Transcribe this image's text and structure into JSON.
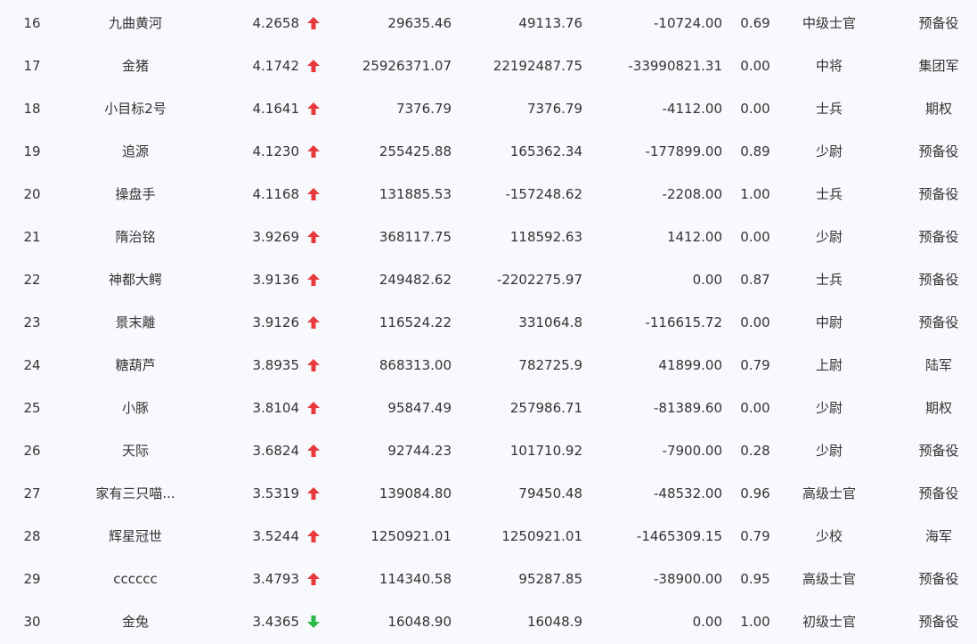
{
  "colors": {
    "up": "#e8393d",
    "down": "#2db845",
    "text": "#333333",
    "background": "#f8f9fc"
  },
  "rows": [
    {
      "rank": "16",
      "name": "九曲黄河",
      "score": "4.2658",
      "trend": "up",
      "trend_icon": "arrow-up-icon",
      "v1": "29635.46",
      "v2": "49113.76",
      "v3": "-10724.00",
      "ratio": "0.69",
      "title": "中级士官",
      "type": "预备役"
    },
    {
      "rank": "17",
      "name": "金猪",
      "score": "4.1742",
      "trend": "up",
      "trend_icon": "arrow-up-icon",
      "v1": "25926371.07",
      "v2": "22192487.75",
      "v3": "-33990821.31",
      "ratio": "0.00",
      "title": "中将",
      "type": "集团军"
    },
    {
      "rank": "18",
      "name": "小目标2号",
      "score": "4.1641",
      "trend": "up",
      "trend_icon": "arrow-up-icon",
      "v1": "7376.79",
      "v2": "7376.79",
      "v3": "-4112.00",
      "ratio": "0.00",
      "title": "士兵",
      "type": "期权"
    },
    {
      "rank": "19",
      "name": "追源",
      "score": "4.1230",
      "trend": "up",
      "trend_icon": "arrow-up-icon",
      "v1": "255425.88",
      "v2": "165362.34",
      "v3": "-177899.00",
      "ratio": "0.89",
      "title": "少尉",
      "type": "预备役"
    },
    {
      "rank": "20",
      "name": "操盘手",
      "score": "4.1168",
      "trend": "up",
      "trend_icon": "arrow-up-icon",
      "v1": "131885.53",
      "v2": "-157248.62",
      "v3": "-2208.00",
      "ratio": "1.00",
      "title": "士兵",
      "type": "预备役"
    },
    {
      "rank": "21",
      "name": "隋治铭",
      "score": "3.9269",
      "trend": "up",
      "trend_icon": "arrow-up-icon",
      "v1": "368117.75",
      "v2": "118592.63",
      "v3": "1412.00",
      "ratio": "0.00",
      "title": "少尉",
      "type": "预备役"
    },
    {
      "rank": "22",
      "name": "神都大鳄",
      "score": "3.9136",
      "trend": "up",
      "trend_icon": "arrow-up-icon",
      "v1": "249482.62",
      "v2": "-2202275.97",
      "v3": "0.00",
      "ratio": "0.87",
      "title": "士兵",
      "type": "预备役"
    },
    {
      "rank": "23",
      "name": "景末離",
      "score": "3.9126",
      "trend": "up",
      "trend_icon": "arrow-up-icon",
      "v1": "116524.22",
      "v2": "331064.8",
      "v3": "-116615.72",
      "ratio": "0.00",
      "title": "中尉",
      "type": "预备役"
    },
    {
      "rank": "24",
      "name": "糖葫芦",
      "score": "3.8935",
      "trend": "up",
      "trend_icon": "arrow-up-icon",
      "v1": "868313.00",
      "v2": "782725.9",
      "v3": "41899.00",
      "ratio": "0.79",
      "title": "上尉",
      "type": "陆军"
    },
    {
      "rank": "25",
      "name": "小豚",
      "score": "3.8104",
      "trend": "up",
      "trend_icon": "arrow-up-icon",
      "v1": "95847.49",
      "v2": "257986.71",
      "v3": "-81389.60",
      "ratio": "0.00",
      "title": "少尉",
      "type": "期权"
    },
    {
      "rank": "26",
      "name": "天际",
      "score": "3.6824",
      "trend": "up",
      "trend_icon": "arrow-up-icon",
      "v1": "92744.23",
      "v2": "101710.92",
      "v3": "-7900.00",
      "ratio": "0.28",
      "title": "少尉",
      "type": "预备役"
    },
    {
      "rank": "27",
      "name": "家有三只喵...",
      "score": "3.5319",
      "trend": "up",
      "trend_icon": "arrow-up-icon",
      "v1": "139084.80",
      "v2": "79450.48",
      "v3": "-48532.00",
      "ratio": "0.96",
      "title": "高级士官",
      "type": "预备役"
    },
    {
      "rank": "28",
      "name": "辉星冠世",
      "score": "3.5244",
      "trend": "up",
      "trend_icon": "arrow-up-icon",
      "v1": "1250921.01",
      "v2": "1250921.01",
      "v3": "-1465309.15",
      "ratio": "0.79",
      "title": "少校",
      "type": "海军"
    },
    {
      "rank": "29",
      "name": "cccccc",
      "score": "3.4793",
      "trend": "up",
      "trend_icon": "arrow-up-icon",
      "v1": "114340.58",
      "v2": "95287.85",
      "v3": "-38900.00",
      "ratio": "0.95",
      "title": "高级士官",
      "type": "预备役"
    },
    {
      "rank": "30",
      "name": "金兔",
      "score": "3.4365",
      "trend": "down",
      "trend_icon": "arrow-down-icon",
      "v1": "16048.90",
      "v2": "16048.9",
      "v3": "0.00",
      "ratio": "1.00",
      "title": "初级士官",
      "type": "预备役"
    }
  ]
}
